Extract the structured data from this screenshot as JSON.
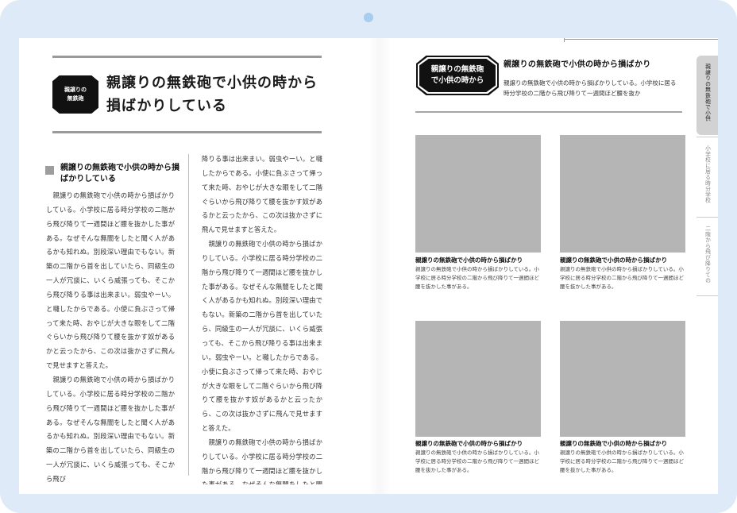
{
  "left_page": {
    "badge": "親譲りの\n無鉄砲",
    "title": "親譲りの無鉄砲で小供の時から損ばかりしている",
    "section_title": "親譲りの無鉄砲で小供の時から損ばかりしている",
    "col1_text": "　親譲りの無鉄砲で小供の時から損ばかりしている。小学校に居る時分学校の二階から飛び降りて一週間ほど腰を抜かした事がある。なぜそんな無闇をしたと聞く人があるかも知れぬ。別段深い理由でもない。新築の二階から首を出していたら、同級生の一人が冗談に、いくら威張っても、そこから飛び降りる事は出来まい。弱虫やーい。と囃したからである。小使に負ぶさって帰って来た時、おやじが大きな眼をして二階ぐらいから飛び降りて腰を抜かす奴があるかと云ったから、この次は抜かさずに飛んで見せますと答えた。\n　親譲りの無鉄砲で小供の時から損ばかりしている。小学校に居る時分学校の二階から飛び降りて一週間ほど腰を抜かした事がある。なぜそんな無闇をしたと聞く人があるかも知れぬ。別段深い理由でもない。新築の二階から首を出していたら、同級生の一人が冗談に、いくら威張っても、そこから飛び",
    "col2_text": "降りる事は出来まい。弱虫やーい。と囃したからである。小使に負ぶさって帰って来た時、おやじが大きな眼をして二階ぐらいから飛び降りて腰を抜かす奴があるかと云ったから、この次は抜かさずに飛んで見せますと答えた。\n　親譲りの無鉄砲で小供の時から損ばかりしている。小学校に居る時分学校の二階から飛び降りて一週間ほど腰を抜かした事がある。なぜそんな無闇をしたと聞く人があるかも知れぬ。別段深い理由でもない。新築の二階から首を出していたら、同級生の一人が冗談に、いくら威張っても、そこから飛び降りる事は出来まい。弱虫やーい。と囃したからである。小使に負ぶさって帰って来た時、おやじが大きな眼をして二階ぐらいから飛び降りて腰を抜かす奴があるかと云ったから、この次は抜かさずに飛んで見せますと答えた。\n　親譲りの無鉄砲で小供の時から損ばかりしている。小学校に居る時分学校の二階から飛び降りて一週間ほど腰を抜かした事がある。なぜそんな無闇をしたと聞く人があるかも知れぬ。別段"
  },
  "right_page": {
    "badge": "親譲りの無鉄砲\nで小供の時から",
    "title": "親譲りの無鉄砲で小供の時から損ばかり",
    "lead": "親譲りの無鉄砲で小供の時から損ばかりしている。小学校に居る時分学校の二階から飛び降りて一週間ほど腰を抜か",
    "figures": [
      {
        "caption_title": "親譲りの無鉄砲で小供の時から損ばかり",
        "caption_body": "親譲りの無鉄砲で小供の時から損ばかりしている。小学校に居る時分学校の二階から飛び降りて一週間ほど腰を抜かした事がある。"
      },
      {
        "caption_title": "親譲りの無鉄砲で小供の時から損ばかり",
        "caption_body": "親譲りの無鉄砲で小供の時から損ばかりしている。小学校に居る時分学校の二階から飛び降りて一週間ほど腰を抜かした事がある。"
      },
      {
        "caption_title": "親譲りの無鉄砲で小供の時から損ばかり",
        "caption_body": "親譲りの無鉄砲で小供の時から損ばかりしている。小学校に居る時分学校の二階から飛び降りて一週間ほど腰を抜かした事がある。"
      },
      {
        "caption_title": "親譲りの無鉄砲で小供の時から損ばかり",
        "caption_body": "親譲りの無鉄砲で小供の時から損ばかりしている。小学校に居る時分学校の二階から飛び降りて一週間ほど腰を抜かした事がある。"
      }
    ]
  },
  "side_tabs": [
    {
      "label": "親譲りの無鉄砲で小供",
      "active": true
    },
    {
      "label": "小学校に居る時分学校",
      "active": false
    },
    {
      "label": "二階から飛び降りての",
      "active": false
    }
  ],
  "colors": {
    "frame": "#deeaf8",
    "camera": "#a9cdee",
    "rule": "#9a9a9a",
    "photo": "#b5b5b5",
    "badge": "#111111",
    "active_tab": "#d2d2d2"
  }
}
